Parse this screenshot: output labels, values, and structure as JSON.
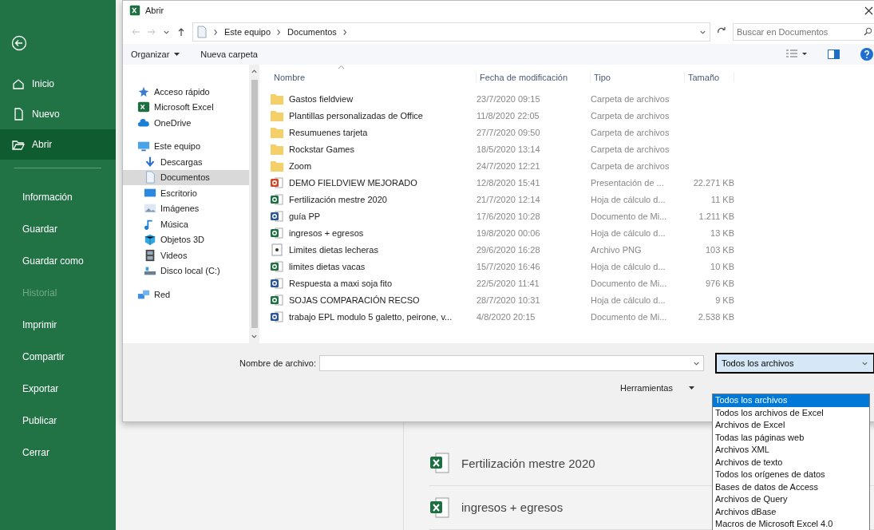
{
  "app_sidebar": {
    "items": [
      {
        "label": "Inicio",
        "kind": "home",
        "selected": false,
        "disabled": false
      },
      {
        "label": "Nuevo",
        "kind": "new",
        "selected": false,
        "disabled": false
      },
      {
        "label": "Abrir",
        "kind": "open",
        "selected": true,
        "disabled": false
      },
      {
        "label": "Información",
        "kind": "text",
        "selected": false,
        "disabled": false
      },
      {
        "label": "Guardar",
        "kind": "text",
        "selected": false,
        "disabled": false
      },
      {
        "label": "Guardar como",
        "kind": "text",
        "selected": false,
        "disabled": false
      },
      {
        "label": "Historial",
        "kind": "text",
        "selected": false,
        "disabled": true
      },
      {
        "label": "Imprimir",
        "kind": "text",
        "selected": false,
        "disabled": false
      },
      {
        "label": "Compartir",
        "kind": "text",
        "selected": false,
        "disabled": false
      },
      {
        "label": "Exportar",
        "kind": "text",
        "selected": false,
        "disabled": false
      },
      {
        "label": "Publicar",
        "kind": "text",
        "selected": false,
        "disabled": false
      },
      {
        "label": "Cerrar",
        "kind": "text",
        "selected": false,
        "disabled": false
      }
    ]
  },
  "dialog": {
    "title": "Abrir",
    "breadcrumb": [
      "Este equipo",
      "Documentos"
    ],
    "search": {
      "placeholder": "Buscar en Documentos"
    },
    "toolbar": {
      "organize": "Organizar",
      "new_folder": "Nueva carpeta"
    },
    "nav": [
      {
        "label": "Acceso rápido",
        "kind": "star",
        "selected": false
      },
      {
        "label": "Microsoft Excel",
        "kind": "excel",
        "selected": false
      },
      {
        "label": "OneDrive",
        "kind": "cloud",
        "selected": false
      },
      {
        "label": "Este equipo",
        "kind": "computer",
        "selected": false,
        "children": [
          {
            "label": "Descargas",
            "kind": "download",
            "selected": false
          },
          {
            "label": "Documentos",
            "kind": "document",
            "selected": true
          },
          {
            "label": "Escritorio",
            "kind": "desktop",
            "selected": false
          },
          {
            "label": "Imágenes",
            "kind": "images",
            "selected": false
          },
          {
            "label": "Música",
            "kind": "music",
            "selected": false
          },
          {
            "label": "Objetos 3D",
            "kind": "cube",
            "selected": false
          },
          {
            "label": "Videos",
            "kind": "film",
            "selected": false
          },
          {
            "label": "Disco local (C:)",
            "kind": "drive",
            "selected": false
          }
        ]
      },
      {
        "label": "Red",
        "kind": "network",
        "selected": false
      }
    ],
    "columns": [
      "Nombre",
      "Fecha de modificación",
      "Tipo",
      "Tamaño"
    ],
    "files": [
      {
        "name": "Gastos fieldview",
        "date": "23/7/2020 09:15",
        "type": "Carpeta de archivos",
        "kind": "folder"
      },
      {
        "name": "Plantillas personalizadas de Office",
        "date": "11/8/2020 22:05",
        "type": "Carpeta de archivos",
        "kind": "folder"
      },
      {
        "name": "Resumuenes tarjeta",
        "date": "27/7/2020 09:50",
        "type": "Carpeta de archivos",
        "kind": "folder"
      },
      {
        "name": "Rockstar Games",
        "date": "18/5/2020 13:14",
        "type": "Carpeta de archivos",
        "kind": "folder"
      },
      {
        "name": "Zoom",
        "date": "24/7/2020 12:21",
        "type": "Carpeta de archivos",
        "kind": "folder"
      },
      {
        "name": "DEMO FIELDVIEW MEJORADO",
        "date": "12/8/2020 15:41",
        "type": "Presentación de ...",
        "size": "22.271 KB",
        "kind": "presentation"
      },
      {
        "name": "Fertilización mestre 2020",
        "date": "21/7/2020 12:14",
        "type": "Hoja de cálculo d...",
        "size": "11 KB",
        "kind": "spreadsheet"
      },
      {
        "name": "guía PP",
        "date": "17/6/2020 10:28",
        "type": "Documento de Mi...",
        "size": "1.211 KB",
        "kind": "document"
      },
      {
        "name": "ingresos + egresos",
        "date": "19/8/2020 00:06",
        "type": "Hoja de cálculo d...",
        "size": "13 KB",
        "kind": "spreadsheet"
      },
      {
        "name": "Limites dietas lecheras",
        "date": "29/6/2020 16:28",
        "type": "Archivo PNG",
        "size": "103 KB",
        "kind": "image"
      },
      {
        "name": "limites dietas vacas",
        "date": "15/7/2020 16:46",
        "type": "Hoja de cálculo d...",
        "size": "10 KB",
        "kind": "spreadsheet"
      },
      {
        "name": "Respuesta a maxi soja fito",
        "date": "22/5/2020 11:41",
        "type": "Documento de Mi...",
        "size": "976 KB",
        "kind": "document"
      },
      {
        "name": "SOJAS COMPARACIÓN RECSO",
        "date": "28/7/2020 10:31",
        "type": "Hoja de cálculo d...",
        "size": "9 KB",
        "kind": "spreadsheet"
      },
      {
        "name": "trabajo EPL modulo 5 galetto, peirone, v...",
        "date": "4/8/2020 20:15",
        "type": "Documento de Mi...",
        "size": "2.538 KB",
        "kind": "document"
      }
    ],
    "file_name": {
      "label": "Nombre de archivo:"
    },
    "filter": {
      "value": "Todos los archivos",
      "options": [
        {
          "label": "Todos los archivos",
          "selected": true
        },
        {
          "label": "Todos los archivos de Excel",
          "selected": false
        },
        {
          "label": "Archivos de Excel",
          "selected": false
        },
        {
          "label": "Todas las páginas web",
          "selected": false
        },
        {
          "label": "Archivos XML",
          "selected": false
        },
        {
          "label": "Archivos de texto",
          "selected": false
        },
        {
          "label": "Todos los orígenes de datos",
          "selected": false
        },
        {
          "label": "Bases de datos de Access",
          "selected": false
        },
        {
          "label": "Archivos de Query",
          "selected": false
        },
        {
          "label": "Archivos dBase",
          "selected": false
        },
        {
          "label": "Macros de Microsoft Excel 4.0",
          "selected": false
        }
      ]
    },
    "tools": "Herramientas"
  },
  "recent": [
    {
      "name": "Fertilización mestre 2020"
    },
    {
      "name": "ingresos + egresos"
    }
  ]
}
